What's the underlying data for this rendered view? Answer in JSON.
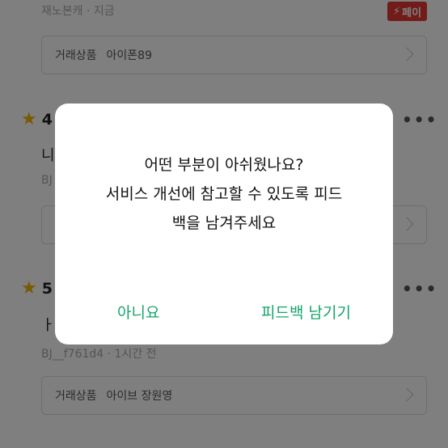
{
  "review1": {
    "author_meta": "재노본캐 · 지금",
    "pay_badge": "페이",
    "product_label": "거래상품",
    "product_name": "아이폰89"
  },
  "review2": {
    "score": "4",
    "text": "니",
    "author": "BJ"
  },
  "review3": {
    "score": "5",
    "text": "ㅏ",
    "author_meta": "BJ__f761d4 · 1시간 전",
    "product_label": "거래상품",
    "product_name": "아이브 장원영"
  },
  "more_menu": "•••",
  "dialog": {
    "message_line1": "어떤 부분이 아쉬웠나요?",
    "message_line2": "서비스 개선에 참고할 수 있도록 피드",
    "message_line3": "백을 남겨주세요",
    "cancel_label": "아니요",
    "confirm_label": "피드백 남기기"
  },
  "colors": {
    "accent": "#16a46a",
    "pay_red": "#e53935",
    "star": "#f0b400"
  }
}
